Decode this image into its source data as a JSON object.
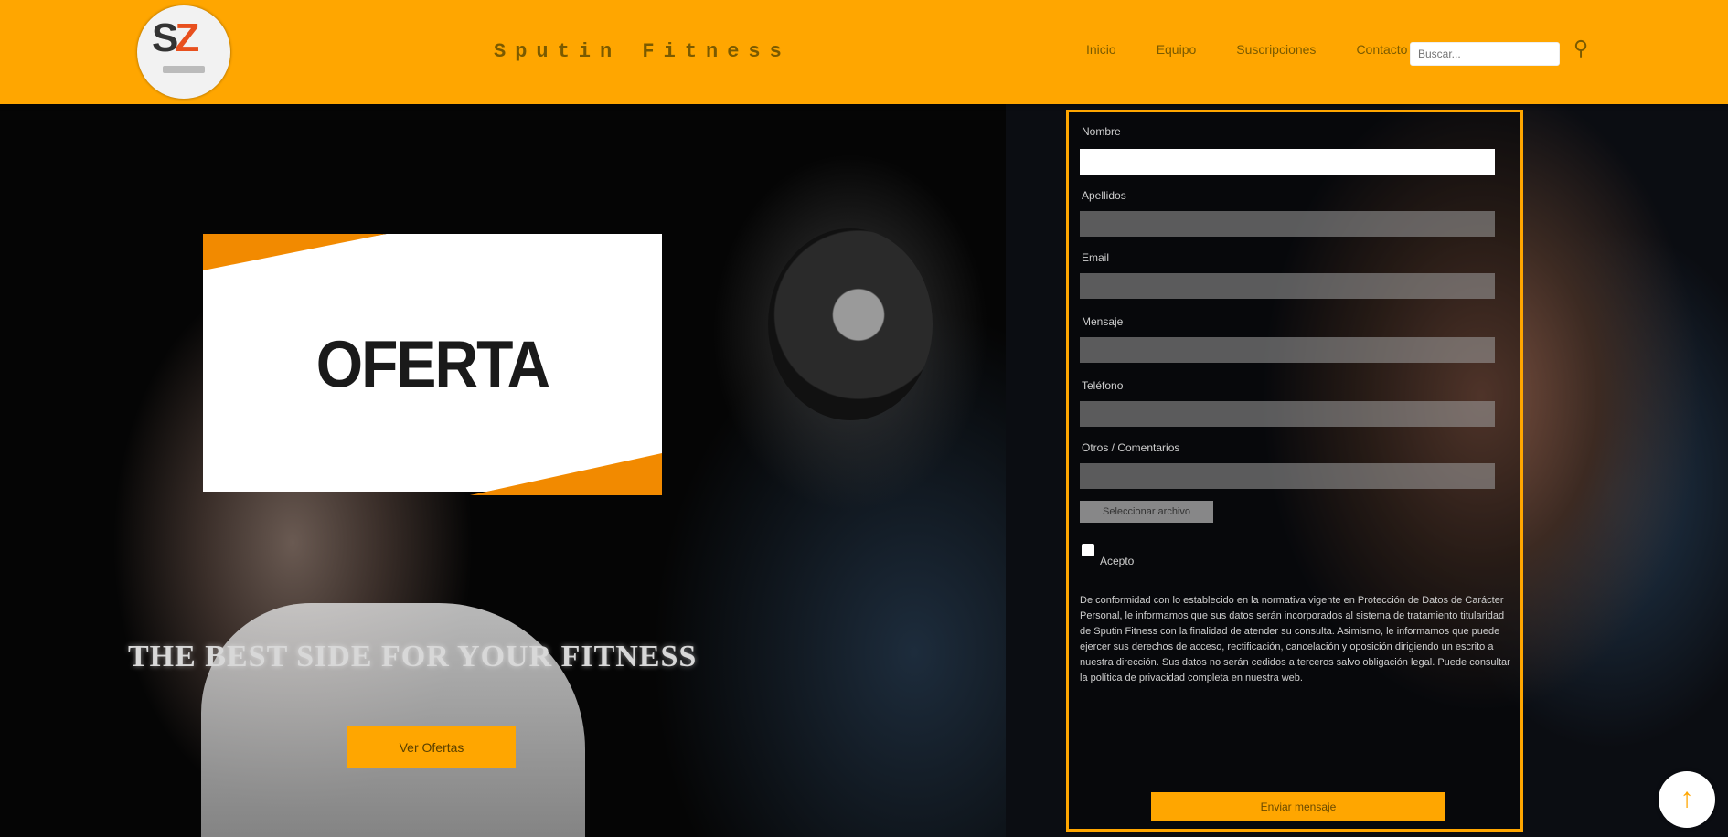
{
  "header": {
    "logo_text": "SZ",
    "site_title": "Sputin Fitness",
    "nav": [
      {
        "label": "Inicio"
      },
      {
        "label": "Equipo"
      },
      {
        "label": "Suscripciones"
      },
      {
        "label": "Contacto"
      }
    ],
    "search_placeholder": "Buscar...",
    "search_icon": "search-icon"
  },
  "hero": {
    "offer_label": "OFERTA",
    "tagline": "THE BEST SIDE FOR YOUR FITNESS",
    "cta_label": "Ver Ofertas"
  },
  "form": {
    "fields": [
      {
        "label": "Nombre",
        "value": ""
      },
      {
        "label": "Apellidos",
        "value": ""
      },
      {
        "label": "Email",
        "value": ""
      },
      {
        "label": "Mensaje",
        "value": ""
      },
      {
        "label": "Teléfono",
        "value": ""
      },
      {
        "label": "Otros / Comentarios",
        "value": ""
      }
    ],
    "file_button": "Seleccionar archivo",
    "checkbox_label": "Acepto",
    "policy_text": "De conformidad con lo establecido en la normativa vigente en Protección de Datos de Carácter Personal, le informamos que sus datos serán incorporados al sistema de tratamiento titularidad de Sputin Fitness con la finalidad de atender su consulta. Asimismo, le informamos que puede ejercer sus derechos de acceso, rectificación, cancelación y oposición dirigiendo un escrito a nuestra dirección. Sus datos no serán cedidos a terceros salvo obligación legal. Puede consultar la política de privacidad completa en nuestra web.",
    "submit_label": "Enviar mensaje"
  },
  "scroll_top_icon": "arrow-up-icon",
  "colors": {
    "accent": "#ffa600",
    "offer_stripe": "#f28a00",
    "background": "#000000"
  }
}
